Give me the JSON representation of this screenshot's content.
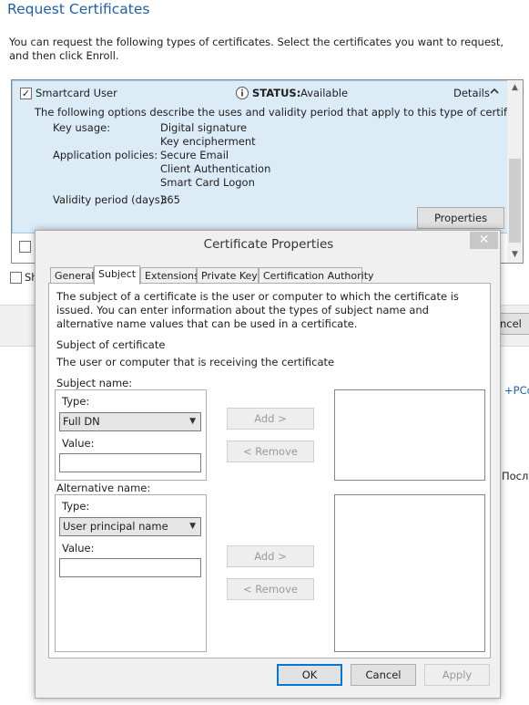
{
  "wizard": {
    "title": "Request Certificates",
    "description": "You can request the following types of certificates. Select the certificates you want to request, and then click Enroll.",
    "certificate": {
      "checked": "✓",
      "name": "Smartcard User",
      "status_label": "STATUS:",
      "status_value": "Available",
      "details_label": "Details",
      "options_intro": "The following options describe the uses and validity period that apply to this type of certificate:",
      "key_usage_label": "Key usage:",
      "key_usage": [
        "Digital signature",
        "Key encipherment"
      ],
      "app_policies_label": "Application policies:",
      "app_policies": [
        "Secure Email",
        "Client Authentication",
        "Smart Card Logon"
      ],
      "validity_label": "Validity period (days):",
      "validity_value": "365",
      "properties_button": "Properties"
    },
    "show_all_label_partial": "Sh",
    "cancel_partial": "ncel",
    "right_text_1": "+PCo",
    "right_text_2": "После"
  },
  "dialog": {
    "title": "Certificate Properties",
    "close_glyph": "✕",
    "tabs": [
      "General",
      "Subject",
      "Extensions",
      "Private Key",
      "Certification Authority"
    ],
    "active_tab": "Subject",
    "intro": "The subject of a certificate is the user or computer to which the certificate is issued. You can enter information about the types of subject name and alternative name values that can be used in a certificate.",
    "subject_of_certificate_label": "Subject of certificate",
    "subject_of_certificate_desc": "The user or computer that is receiving the certificate",
    "subject_name": {
      "label": "Subject name:",
      "type_label": "Type:",
      "type_value": "Full DN",
      "value_label": "Value:",
      "value": ""
    },
    "alternative_name": {
      "label": "Alternative name:",
      "type_label": "Type:",
      "type_value": "User principal name",
      "value_label": "Value:",
      "value": ""
    },
    "add_button": "Add >",
    "remove_button": "< Remove",
    "ok_button": "OK",
    "cancel_button": "Cancel",
    "apply_button": "Apply"
  }
}
